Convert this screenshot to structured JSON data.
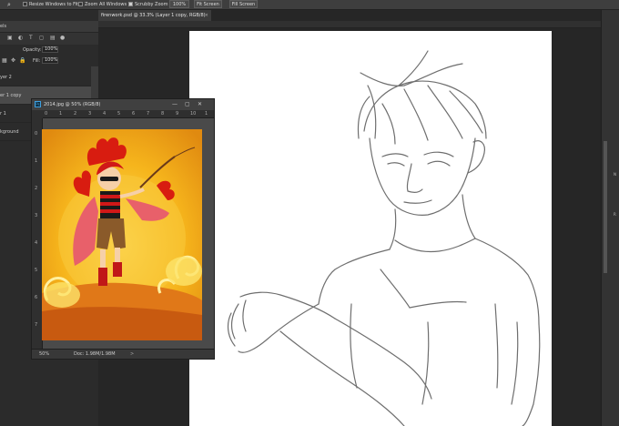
{
  "options_bar": {
    "resize_windows": "Resize Windows to Fit",
    "zoom_all_windows": "Zoom All Windows",
    "scrubby_zoom": "Scrubby Zoom",
    "zoom_percent": "100%",
    "fit_screen": "Fit Screen",
    "fill_screen": "Fill Screen"
  },
  "layers_panel": {
    "title": "els",
    "opacity_label": "Opacity:",
    "opacity_value": "100%",
    "fill_label": "Fill:",
    "fill_value": "100%",
    "layers": [
      {
        "name": "yer 2",
        "selected": false
      },
      {
        "name": "er 1 copy",
        "selected": true
      },
      {
        "name": "r 1",
        "selected": false
      },
      {
        "name": "kground",
        "selected": false
      }
    ]
  },
  "document": {
    "tab_title": "firenwork.psd @ 33.3% (Layer 1 copy, RGB/8)",
    "close": "×"
  },
  "floating_window": {
    "title": "2014.jpg @ 50% (RGB/8)",
    "ps_icon": "Ps",
    "hruler": [
      "0",
      "1",
      "2",
      "3",
      "4",
      "5",
      "6",
      "7",
      "8",
      "9",
      "10",
      "1"
    ],
    "vruler": [
      "0",
      "1",
      "2",
      "3",
      "4",
      "5",
      "6",
      "7"
    ],
    "status_zoom": "50%",
    "status_doc": "Doc: 1.98M/1.98M",
    "status_arrow": ">"
  },
  "right_panel": {
    "label_top": "N",
    "label_mid": "R"
  },
  "colors": {
    "ui_dark": "#282828",
    "panel": "#3c3c3c",
    "selection": "#4a4a4a",
    "ps_blue": "#3ea0e0",
    "art_orange": "#f0a818",
    "art_red": "#c01818"
  }
}
